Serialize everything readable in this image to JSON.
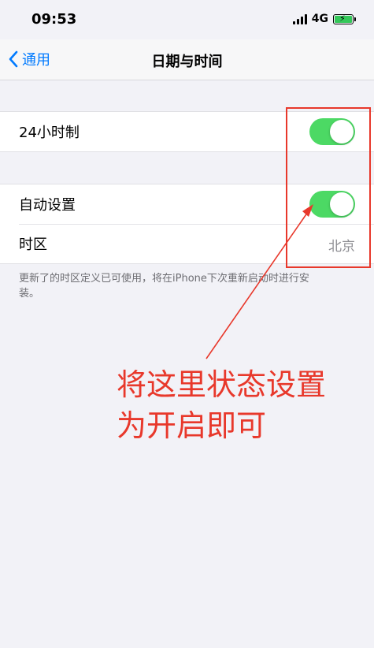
{
  "status_bar": {
    "time": "09:53",
    "network": "4G",
    "signal_bars": 4,
    "battery_icon": "battery-charging-icon",
    "accent_battery": "#34c759"
  },
  "nav": {
    "back_label": "通用",
    "back_icon": "chevron-left-icon",
    "title": "日期与时间",
    "accent": "#007aff"
  },
  "groups": [
    {
      "rows": [
        {
          "label": "24小时制",
          "control": "toggle",
          "on": true
        }
      ]
    },
    {
      "rows": [
        {
          "label": "自动设置",
          "control": "toggle",
          "on": true
        },
        {
          "label": "时区",
          "value": "北京"
        }
      ]
    }
  ],
  "footnote": "更新了的时区定义已可使用，将在iPhone下次重新启动时进行安装。",
  "annotation": {
    "line1": "将这里状态设置",
    "line2": "为开启即可",
    "color": "#e8382b"
  },
  "toggle_on_color": "#4cd964"
}
